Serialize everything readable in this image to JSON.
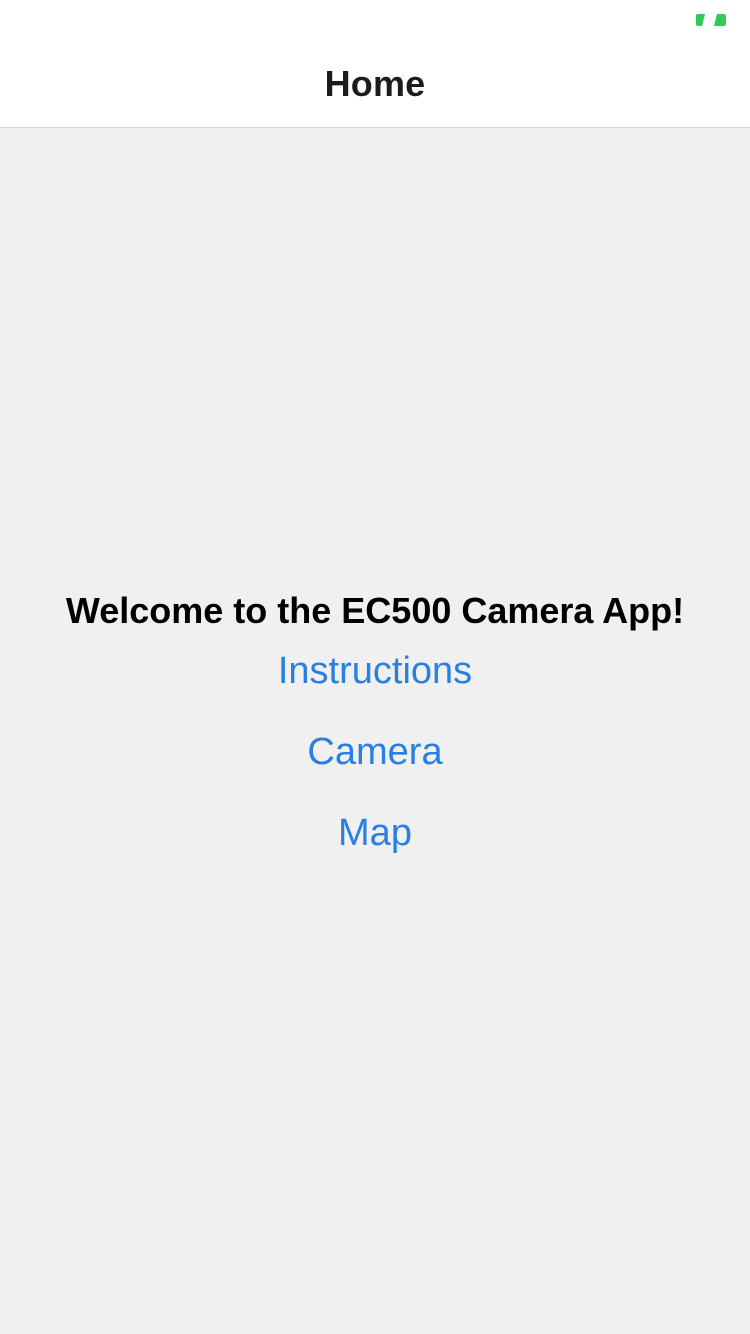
{
  "status_bar": {
    "battery_icon": "battery-icon",
    "battery_color": "#34c759"
  },
  "nav": {
    "title": "Home"
  },
  "main": {
    "welcome_text": "Welcome to the EC500 Camera App!",
    "buttons": [
      {
        "label": "Instructions"
      },
      {
        "label": "Camera"
      },
      {
        "label": "Map"
      }
    ],
    "link_color": "#2a7fe0"
  }
}
